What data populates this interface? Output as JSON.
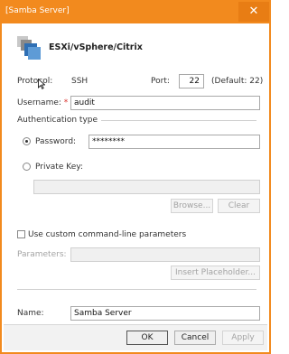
{
  "window": {
    "title": "[Samba Server]",
    "close_symbol": "✕"
  },
  "header": {
    "product_name": "ESXi/vSphere/Citrix"
  },
  "connection": {
    "protocol_label": "Protocol:",
    "protocol_value": "SSH",
    "port_label": "Port:",
    "port_value": "22",
    "port_default": "(Default: 22)",
    "username_label": "Username:",
    "required_mark": "*",
    "username_value": "audit"
  },
  "auth": {
    "section_title": "Authentication type",
    "password_label": "Password:",
    "password_value": "********",
    "password_selected": true,
    "private_key_label": "Private Key:",
    "private_key_value": "",
    "browse_label": "Browse...",
    "clear_label": "Clear"
  },
  "custom": {
    "checkbox_label": "Use custom command-line parameters",
    "checked": false,
    "parameters_label": "Parameters:",
    "parameters_value": "",
    "insert_placeholder_label": "Insert Placeholder..."
  },
  "name": {
    "label": "Name:",
    "value": "Samba Server"
  },
  "buttons": {
    "ok": "OK",
    "cancel": "Cancel",
    "apply": "Apply"
  },
  "colors": {
    "titlebar": "#f28a1e",
    "required": "#d9312b"
  }
}
